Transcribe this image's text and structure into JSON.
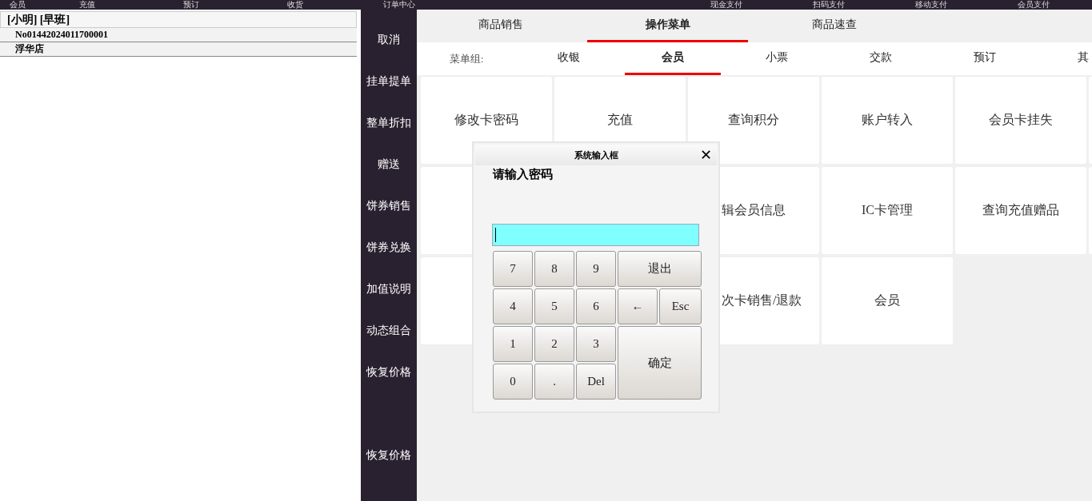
{
  "top_bar": [
    "会员",
    "充值",
    "预订",
    "收货",
    "订单中心",
    "现金支付",
    "扫码支付",
    "移动支付",
    "会员支付"
  ],
  "order_panel": {
    "operator": "[小明] [早班]",
    "order_no": "No01442024011700001",
    "store": "浮华店"
  },
  "side_buttons": [
    "取消",
    "挂单提单",
    "整单折扣",
    "赠送",
    "饼券销售",
    "饼券兑换",
    "加值说明",
    "动态组合",
    "恢复价格"
  ],
  "side_bottom_buttons": [
    "恢复价格"
  ],
  "tabs": [
    {
      "label": "商品销售",
      "selected": false
    },
    {
      "label": "操作菜单",
      "selected": true
    },
    {
      "label": "商品速查",
      "selected": false
    }
  ],
  "menu_group": {
    "label": "菜单组:",
    "groups": [
      {
        "label": "收银",
        "selected": false
      },
      {
        "label": "会员",
        "selected": true
      },
      {
        "label": "小票",
        "selected": false
      },
      {
        "label": "交款",
        "selected": false
      },
      {
        "label": "预订",
        "selected": false
      },
      {
        "label": "其",
        "selected": false
      }
    ]
  },
  "menu_items": [
    {
      "kind": "full",
      "label": "修改卡密码"
    },
    {
      "kind": "full",
      "label": "充值"
    },
    {
      "kind": "full",
      "label": "查询积分"
    },
    {
      "kind": "full",
      "label": "账户转入"
    },
    {
      "kind": "full",
      "label": "会员卡挂失"
    },
    {
      "kind": "edge"
    },
    {
      "kind": "hidden"
    },
    {
      "kind": "covered"
    },
    {
      "kind": "clip-left",
      "label": "辑会员信息"
    },
    {
      "kind": "full",
      "label": "IC卡管理"
    },
    {
      "kind": "full",
      "label": "查询充值赠品"
    },
    {
      "kind": "edge"
    },
    {
      "kind": "hidden"
    },
    {
      "kind": "covered"
    },
    {
      "kind": "clip-left",
      "label": "次卡销售/退款"
    },
    {
      "kind": "full",
      "label": "会员"
    }
  ],
  "dialog": {
    "title": "系统输入框",
    "close": "✕",
    "prompt": "请输入密码",
    "keys": [
      {
        "kind": "key",
        "label": "7"
      },
      {
        "kind": "key",
        "label": "8"
      },
      {
        "kind": "key",
        "label": "9"
      },
      {
        "kind": "wide",
        "label": "退出"
      },
      {
        "kind": "key",
        "label": "4"
      },
      {
        "kind": "key",
        "label": "5"
      },
      {
        "kind": "key",
        "label": "6"
      },
      {
        "kind": "key",
        "label": "←"
      },
      {
        "kind": "key",
        "label": "Esc"
      },
      {
        "kind": "key",
        "label": "1"
      },
      {
        "kind": "key",
        "label": "2"
      },
      {
        "kind": "key",
        "label": "3"
      },
      {
        "kind": "big",
        "label": "确定"
      },
      {
        "kind": "key",
        "label": "0"
      },
      {
        "kind": "key",
        "label": "."
      },
      {
        "kind": "key",
        "label": "Del"
      }
    ]
  }
}
